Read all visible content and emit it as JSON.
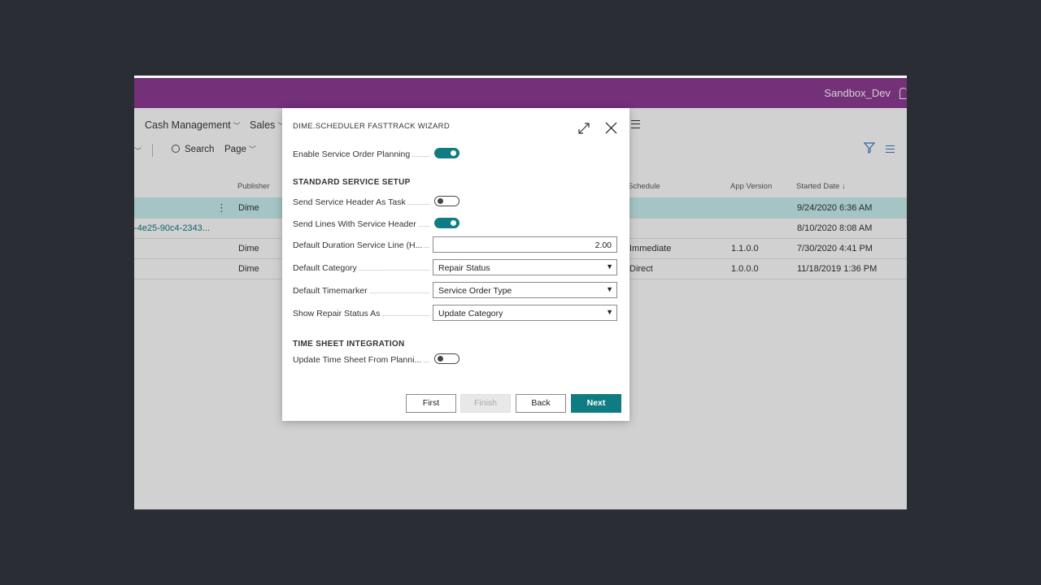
{
  "header": {
    "environment": "Sandbox_Dev"
  },
  "menu": {
    "items": [
      "Cash Management",
      "Sales"
    ]
  },
  "actions": {
    "search": "Search",
    "page": "Page"
  },
  "table": {
    "columns": [
      "Publisher",
      "Schedule",
      "App Version",
      "Started Date ↓"
    ],
    "rows": [
      {
        "id": "",
        "publisher": "Dime",
        "schedule": "",
        "version": "",
        "started": "9/24/2020 6:36 AM"
      },
      {
        "id": "-4e25-90c4-2343...",
        "publisher": "",
        "schedule": "",
        "version": "",
        "started": "8/10/2020 8:08 AM"
      },
      {
        "id": "",
        "publisher": "Dime",
        "schedule": "Immediate",
        "version": "1.1.0.0",
        "started": "7/30/2020 4:41 PM"
      },
      {
        "id": "",
        "publisher": "Dime",
        "schedule": "Direct",
        "version": "1.0.0.0",
        "started": "11/18/2019 1:36 PM"
      }
    ]
  },
  "dialog": {
    "title": "DIME.SCHEDULER FASTTRACK WIZARD",
    "enable_label": "Enable Service Order Planning",
    "enable_on": true,
    "section_standard": "STANDARD SERVICE SETUP",
    "send_header_label": "Send Service Header As Task",
    "send_header_on": false,
    "send_lines_label": "Send Lines With Service Header",
    "send_lines_on": true,
    "duration_label": "Default Duration Service Line (H...",
    "duration_value": "2.00",
    "category_label": "Default Category",
    "category_value": "Repair Status",
    "timemarker_label": "Default Timemarker",
    "timemarker_value": "Service Order Type",
    "repair_label": "Show Repair Status As",
    "repair_value": "Update Category",
    "section_timesheet": "TIME SHEET INTEGRATION",
    "timesheet_label": "Update Time Sheet From Planni...",
    "timesheet_on": false,
    "buttons": {
      "first": "First",
      "finish": "Finish",
      "back": "Back",
      "next": "Next"
    }
  },
  "colors": {
    "accent": "#0f7c83",
    "brand": "#8e3b94",
    "selected_row": "#c9f1f0"
  }
}
